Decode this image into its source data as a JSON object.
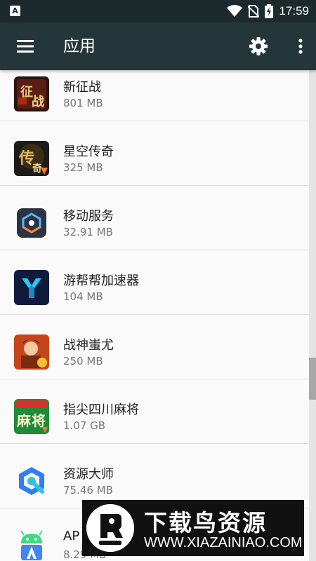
{
  "status_bar": {
    "time": "17:59",
    "left_icon_letter": "A"
  },
  "app_bar": {
    "title": "应用"
  },
  "apps": [
    {
      "name": "新征战",
      "size": "801 MB",
      "icon": "game-icon-xinzhengzhan"
    },
    {
      "name": "星空传奇",
      "size": "325 MB",
      "icon": "game-icon-xingkongchuanqi"
    },
    {
      "name": "移动服务",
      "size": "32.91 MB",
      "icon": "mobile-service-icon"
    },
    {
      "name": "游帮帮加速器",
      "size": "104 MB",
      "icon": "accelerator-icon"
    },
    {
      "name": "战神蚩尤",
      "size": "250 MB",
      "icon": "game-icon-zhanshenchiyou"
    },
    {
      "name": "指尖四川麻将",
      "size": "1.07 GB",
      "icon": "mahjong-icon"
    },
    {
      "name": "资源大师",
      "size": "75.46 MB",
      "icon": "resource-master-icon"
    },
    {
      "name": "AP",
      "size": "8.29 MB",
      "icon": "android-app-icon"
    }
  ],
  "watermark": {
    "title": "下载鸟资源",
    "url": "WWW.XIAZAINIAO.COM"
  }
}
